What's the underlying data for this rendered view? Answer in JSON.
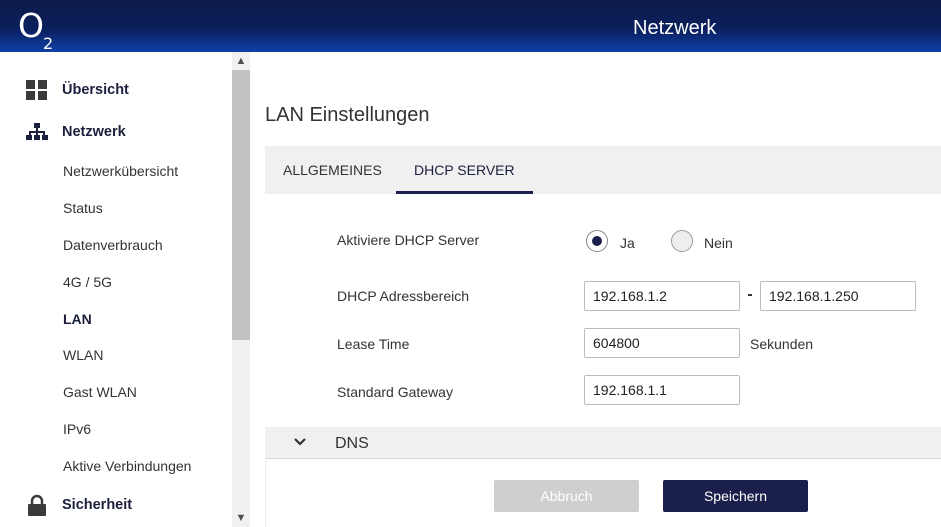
{
  "header": {
    "logo_main": "O",
    "logo_sub": "2",
    "title": "Netzwerk"
  },
  "sidebar": {
    "main_items": [
      {
        "label": "Übersicht",
        "icon": "grid-icon"
      },
      {
        "label": "Netzwerk",
        "icon": "network-icon"
      },
      {
        "label": "Sicherheit",
        "icon": "lock-icon"
      }
    ],
    "sub_items": [
      {
        "label": "Netzwerkübersicht",
        "active": false
      },
      {
        "label": "Status",
        "active": false
      },
      {
        "label": "Datenverbrauch",
        "active": false
      },
      {
        "label": "4G / 5G",
        "active": false
      },
      {
        "label": "LAN",
        "active": true
      },
      {
        "label": "WLAN",
        "active": false
      },
      {
        "label": "Gast WLAN",
        "active": false
      },
      {
        "label": "IPv6",
        "active": false
      },
      {
        "label": "Aktive Verbindungen",
        "active": false
      }
    ]
  },
  "main": {
    "page_title": "LAN Einstellungen",
    "tabs": [
      {
        "label": "ALLGEMEINES",
        "active": false
      },
      {
        "label": "DHCP SERVER",
        "active": true
      }
    ],
    "form": {
      "dhcp_label": "Aktiviere DHCP Server",
      "radio_yes": "Ja",
      "radio_no": "Nein",
      "radio_selected": "Ja",
      "range_label": "DHCP Adressbereich",
      "range_start": "192.168.1.2",
      "range_end": "192.168.1.250",
      "lease_label": "Lease Time",
      "lease_value": "604800",
      "lease_unit": "Sekunden",
      "gateway_label": "Standard Gateway",
      "gateway_value": "192.168.1.1"
    },
    "dns_section": {
      "label": "DNS"
    },
    "buttons": {
      "cancel": "Abbruch",
      "save": "Speichern"
    }
  },
  "colors": {
    "header_dark": "#0d1b4a",
    "header_light": "#0f3fa8",
    "accent": "#1b1f4b",
    "disabled_button": "#cfcfcf"
  }
}
